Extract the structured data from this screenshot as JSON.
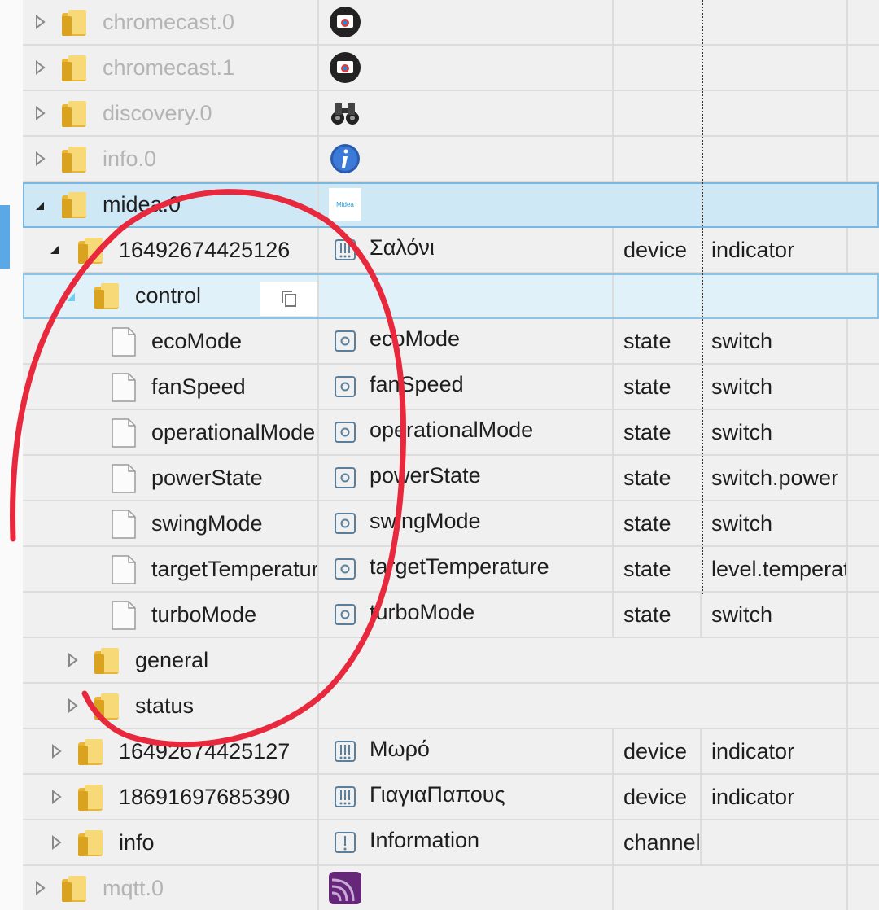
{
  "rows": [
    {
      "name": "chromecast.0",
      "icon": "chromecast-icon",
      "grey": true,
      "arrow": "collapsed"
    },
    {
      "name": "chromecast.1",
      "icon": "chromecast-icon",
      "grey": true,
      "arrow": "collapsed"
    },
    {
      "name": "discovery.0",
      "icon": "binoculars-icon",
      "grey": true,
      "arrow": "collapsed"
    },
    {
      "name": "info.0",
      "icon": "info-icon",
      "grey": true,
      "arrow": "collapsed"
    },
    {
      "name": "midea.0",
      "icon": "midea-logo",
      "grey": false,
      "arrow": "expanded",
      "selected": true
    },
    {
      "name": "16492674425126",
      "label": "Σαλόνι",
      "type": "device",
      "role": "indicator",
      "icon": "device-icon",
      "arrow": "expanded"
    },
    {
      "name": "control",
      "arrow": "expanded",
      "selected": true
    },
    {
      "name": "ecoMode",
      "label": "ecoMode",
      "type": "state",
      "role": "switch"
    },
    {
      "name": "fanSpeed",
      "label": "fanSpeed",
      "type": "state",
      "role": "switch"
    },
    {
      "name": "operationalMode",
      "label": "operationalMode",
      "type": "state",
      "role": "switch"
    },
    {
      "name": "powerState",
      "label": "powerState",
      "type": "state",
      "role": "switch.power"
    },
    {
      "name": "swingMode",
      "label": "swingMode",
      "type": "state",
      "role": "switch"
    },
    {
      "name": "targetTemperature",
      "label": "targetTemperature",
      "type": "state",
      "role": "level.temperature"
    },
    {
      "name": "turboMode",
      "label": "turboMode",
      "type": "state",
      "role": "switch"
    },
    {
      "name": "general",
      "arrow": "collapsed"
    },
    {
      "name": "status",
      "arrow": "collapsed"
    },
    {
      "name": "16492674425127",
      "label": "Μωρό",
      "type": "device",
      "role": "indicator",
      "icon": "device-icon",
      "arrow": "collapsed"
    },
    {
      "name": "18691697685390",
      "label": "ΓιαγιαΠαπους",
      "type": "device",
      "role": "indicator",
      "icon": "device-icon",
      "arrow": "collapsed"
    },
    {
      "name": "info",
      "label": "Information",
      "type": "channel",
      "role": "",
      "icon": "channel-icon",
      "arrow": "collapsed"
    },
    {
      "name": "mqtt.0",
      "icon": "mqtt-icon",
      "grey": true,
      "arrow": "collapsed"
    }
  ],
  "colors": {
    "selected_row": "#cfe8f6",
    "annotation": "#e8283c",
    "folder": "#f2c94c"
  }
}
